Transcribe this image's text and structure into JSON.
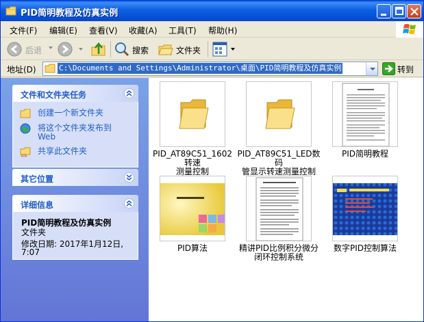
{
  "window": {
    "title": "PID简明教程及仿真实例"
  },
  "menu": {
    "items": [
      "文件(F)",
      "编辑(E)",
      "查看(V)",
      "收藏(A)",
      "工具(T)",
      "帮助(H)"
    ]
  },
  "toolbar": {
    "back_label": "后退",
    "search_label": "搜索",
    "folders_label": "文件夹"
  },
  "address": {
    "label": "地址(D)",
    "path": "C:\\Documents and Settings\\Administrator\\桌面\\PID简明教程及仿真实例",
    "go_label": "转到"
  },
  "left_pane": {
    "tasks": {
      "title": "文件和文件夹任务",
      "items": [
        "创建一个新文件夹",
        "将这个文件夹发布到",
        "Web",
        "共享此文件夹"
      ]
    },
    "other_places": {
      "title": "其它位置"
    },
    "details": {
      "title": "详细信息",
      "name": "PID简明教程及仿真实例",
      "type": "文件夹",
      "modified_label": "修改日期: 2017年1月12日,",
      "modified_time": "7:07"
    }
  },
  "files": [
    {
      "name1": "PID_AT89C51_1602转速",
      "name2": "测量控制",
      "kind": "folder"
    },
    {
      "name1": "PID_AT89C51_LED数码",
      "name2": "管显示转速测量控制",
      "kind": "folder"
    },
    {
      "name1": "PID简明教程",
      "name2": "",
      "kind": "document"
    },
    {
      "name1": "PID算法",
      "name2": "",
      "kind": "presentation-yellow"
    },
    {
      "name1": "精讲PID比例积分微分",
      "name2": "闭环控制系统",
      "kind": "document"
    },
    {
      "name1": "数字PID控制算法",
      "name2": "",
      "kind": "presentation-blue"
    }
  ],
  "colors": {
    "titlebar": "#0a5fe3",
    "task_link": "#215dc6",
    "address_selection": "#316ac5"
  }
}
